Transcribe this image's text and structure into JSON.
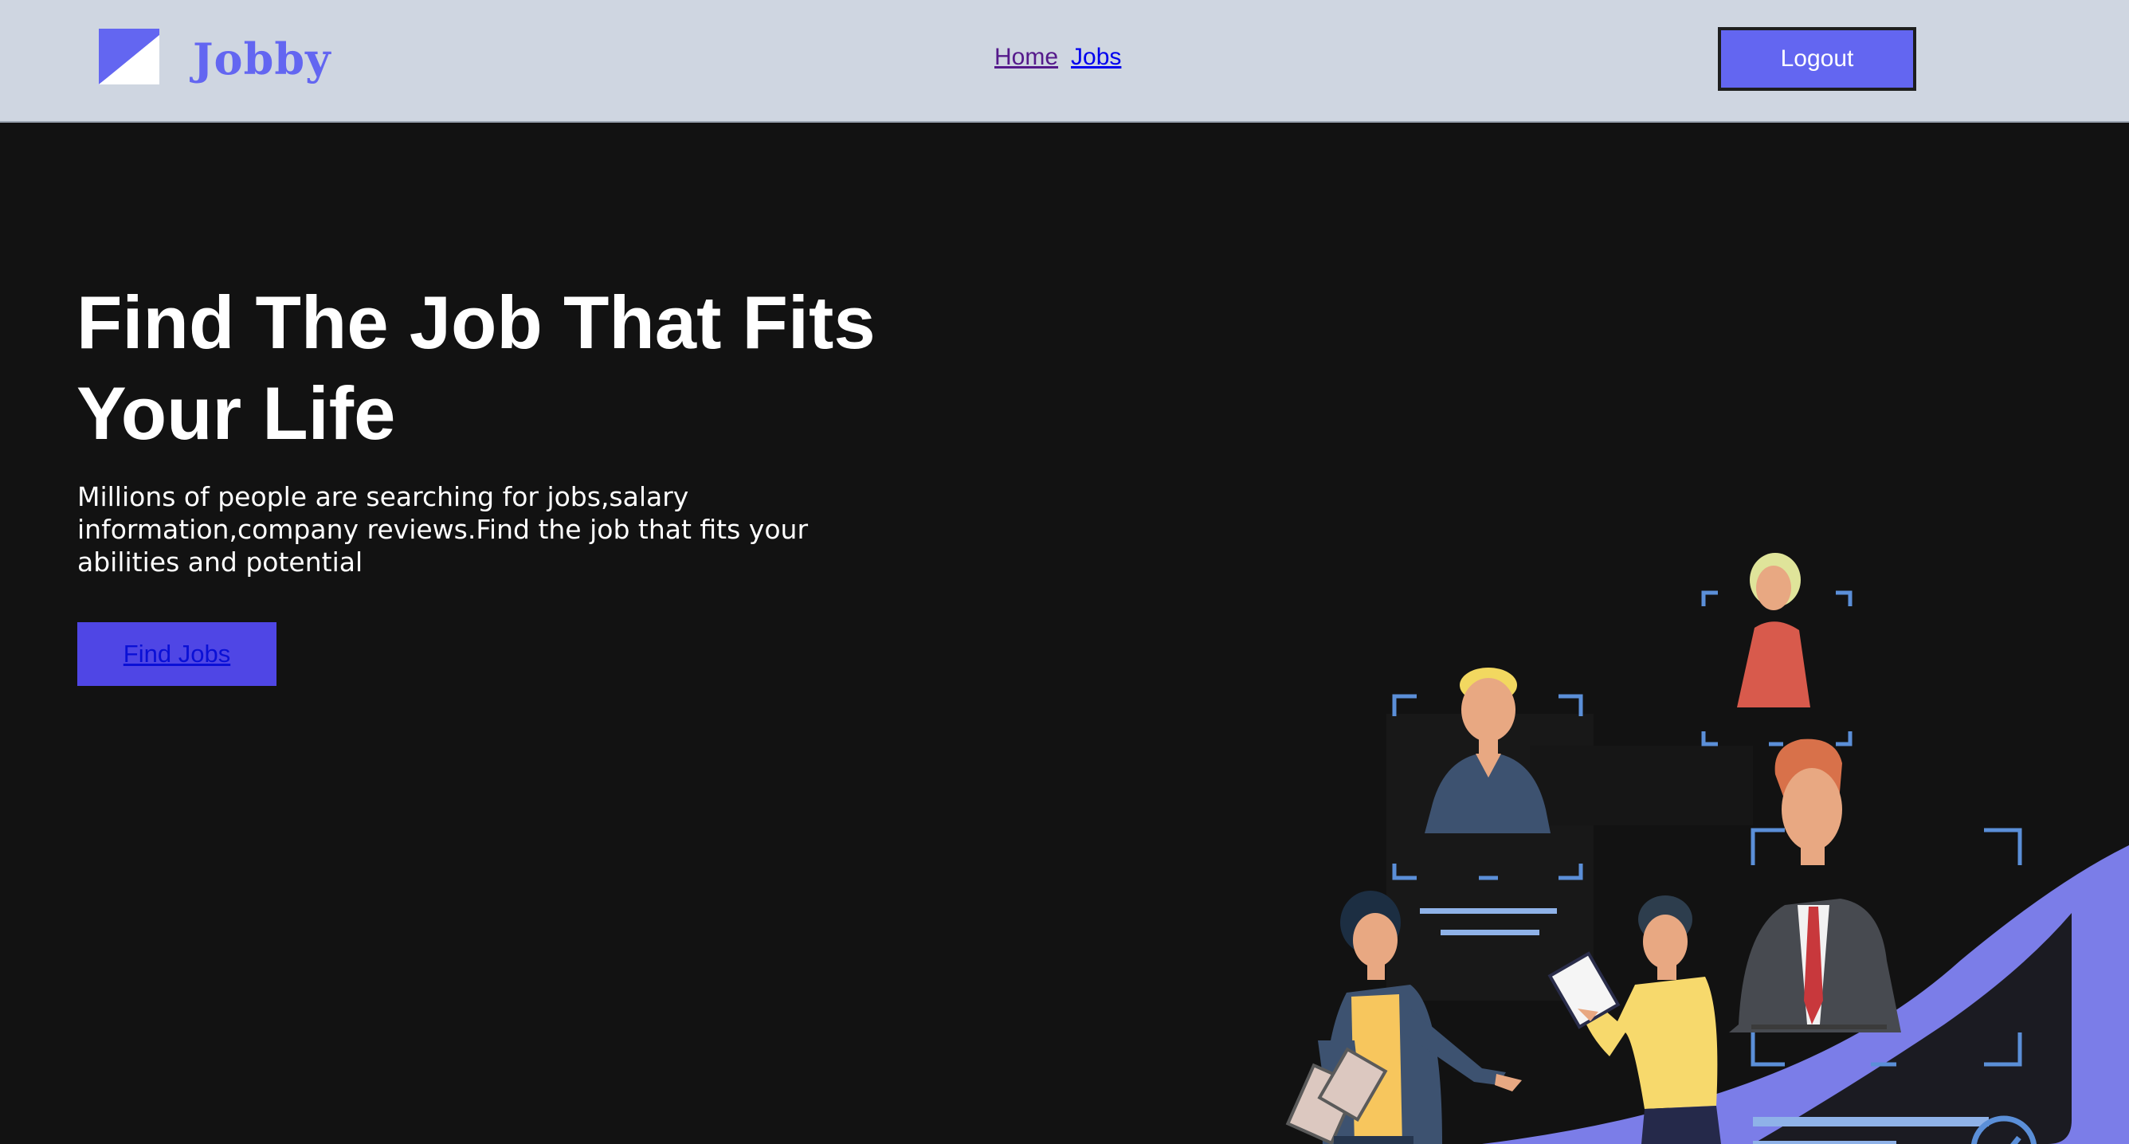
{
  "navbar": {
    "logo_text": "Jobby",
    "logo_icon": "jobby-logo-icon",
    "links": [
      {
        "label": "Home"
      },
      {
        "label": "Jobs"
      }
    ],
    "logout_label": "Logout"
  },
  "hero": {
    "title": "Find The Job That Fits Your Life",
    "description": "Millions of people are searching for jobs,salary information,company reviews.Find the job that fits your abilities and potential",
    "find_jobs_label": "Find Jobs",
    "illustration_icon": "job-candidates-illustration"
  },
  "colors": {
    "brand": "#6366f1",
    "navbar_bg": "#cfd6e1",
    "page_bg": "#121212",
    "button_bg": "#4f46e5"
  }
}
